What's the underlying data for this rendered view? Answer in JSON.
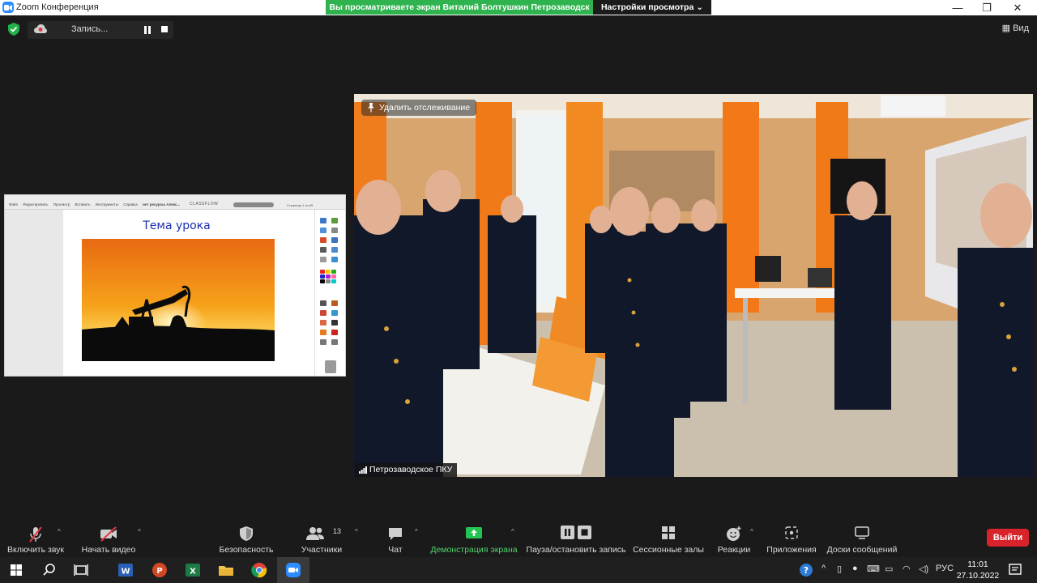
{
  "window": {
    "title": "Zoom Конференция",
    "share_banner": "Вы просматриваете экран Виталий Болтушкин Петрозаводск",
    "view_settings": "Настройки просмотра"
  },
  "topbar": {
    "recording_label": "Запись...",
    "view_label": "Вид"
  },
  "shared_screen": {
    "menu": [
      "Файл",
      "Редактировать",
      "Просмотр",
      "Вставить",
      "Инструменты",
      "Справка"
    ],
    "tab_label": "нет ресурсы Алекс...",
    "brand": "CLASSFLOW",
    "pages": "Страница 1 из 65",
    "slide_title": "Тема урока"
  },
  "video": {
    "untrack_label": "Удалить отслеживание",
    "participant_name": "Петрозаводское ПКУ"
  },
  "toolbar": {
    "unmute": "Включить звук",
    "start_video": "Начать видео",
    "security": "Безопасность",
    "participants": "Участники",
    "participants_count": "13",
    "chat": "Чат",
    "share_screen": "Демонстрация экрана",
    "pause_record": "Пауза/остановить запись",
    "breakout": "Сессионные залы",
    "reactions": "Реакции",
    "apps": "Приложения",
    "whiteboards": "Доски сообщений",
    "leave": "Выйти"
  },
  "taskbar": {
    "language": "РУС",
    "time": "11:01",
    "date": "27.10.2022"
  },
  "colors": {
    "share_banner": "#2fb34e",
    "leave_button": "#d9232b",
    "zoom_blue": "#2d8cff",
    "share_green": "#4fd46b"
  }
}
